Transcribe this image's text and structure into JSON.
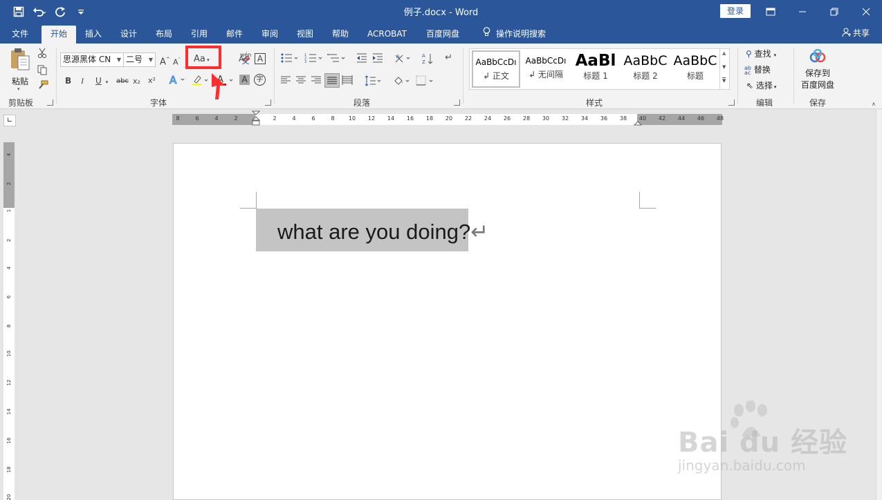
{
  "titlebar": {
    "title": "例子.docx  -  Word",
    "login": "登录",
    "qat": {
      "save_icon": "save-icon",
      "undo_icon": "undo-icon",
      "redo_icon": "redo-icon",
      "customize_icon": "customize-qat-icon"
    },
    "window_controls": [
      "ribbon-display-icon",
      "minimize-icon",
      "restore-icon",
      "close-icon"
    ]
  },
  "tabs": {
    "file": "文件",
    "home": "开始",
    "insert": "插入",
    "design": "设计",
    "layout": "布局",
    "references": "引用",
    "mailings": "邮件",
    "review": "审阅",
    "view": "视图",
    "help": "帮助",
    "acrobat": "ACROBAT",
    "baidu": "百度网盘",
    "tellme": "操作说明搜索",
    "share": "共享"
  },
  "ribbon": {
    "clipboard": {
      "paste": "粘贴",
      "label": "剪贴板"
    },
    "font": {
      "font_name": "思源黑体 CN",
      "font_size": "二号",
      "change_case": "Aa",
      "bold": "B",
      "italic": "I",
      "underline": "U",
      "strike": "abc",
      "subscript": "x₂",
      "superscript": "x²",
      "label": "字体",
      "grow": "A",
      "shrink": "A",
      "phonetic": "wén",
      "char_border": "A",
      "char_shading": "A",
      "enclose": "字"
    },
    "paragraph": {
      "label": "段落"
    },
    "styles": {
      "label": "样式",
      "items": [
        {
          "sample": "AaBbCcDı",
          "name": "↲ 正文"
        },
        {
          "sample": "AaBbCcDı",
          "name": "↲ 无间隔"
        },
        {
          "sample": "AaBl",
          "name": "标题 1"
        },
        {
          "sample": "AaBbC",
          "name": "标题 2"
        },
        {
          "sample": "AaBbC",
          "name": "标题"
        }
      ]
    },
    "editing": {
      "find": "查找",
      "replace": "替换",
      "select": "选择",
      "label": "编辑"
    },
    "save": {
      "line1": "保存到",
      "line2": "百度网盘",
      "label": "保存"
    }
  },
  "ruler": {
    "h_ticks": [
      "8",
      "6",
      "4",
      "2",
      "2",
      "4",
      "6",
      "8",
      "10",
      "12",
      "14",
      "16",
      "18",
      "20",
      "22",
      "24",
      "26",
      "28",
      "30",
      "32",
      "34",
      "36",
      "38",
      "40",
      "42",
      "44",
      "46",
      "48"
    ],
    "v_ticks": [
      "4",
      "2",
      "1",
      "2",
      "4",
      "6",
      "8",
      "10",
      "12",
      "14",
      "16",
      "18",
      "20"
    ]
  },
  "document": {
    "text": "what are you doing?",
    "para_mark": "↵"
  },
  "watermark": {
    "brand": "Bai du 经验",
    "url": "jingyan.baidu.com"
  },
  "colors": {
    "brand_blue": "#2b579a",
    "highlight_red": "#ff2d2d",
    "selection_gray": "#c4c4c4"
  }
}
